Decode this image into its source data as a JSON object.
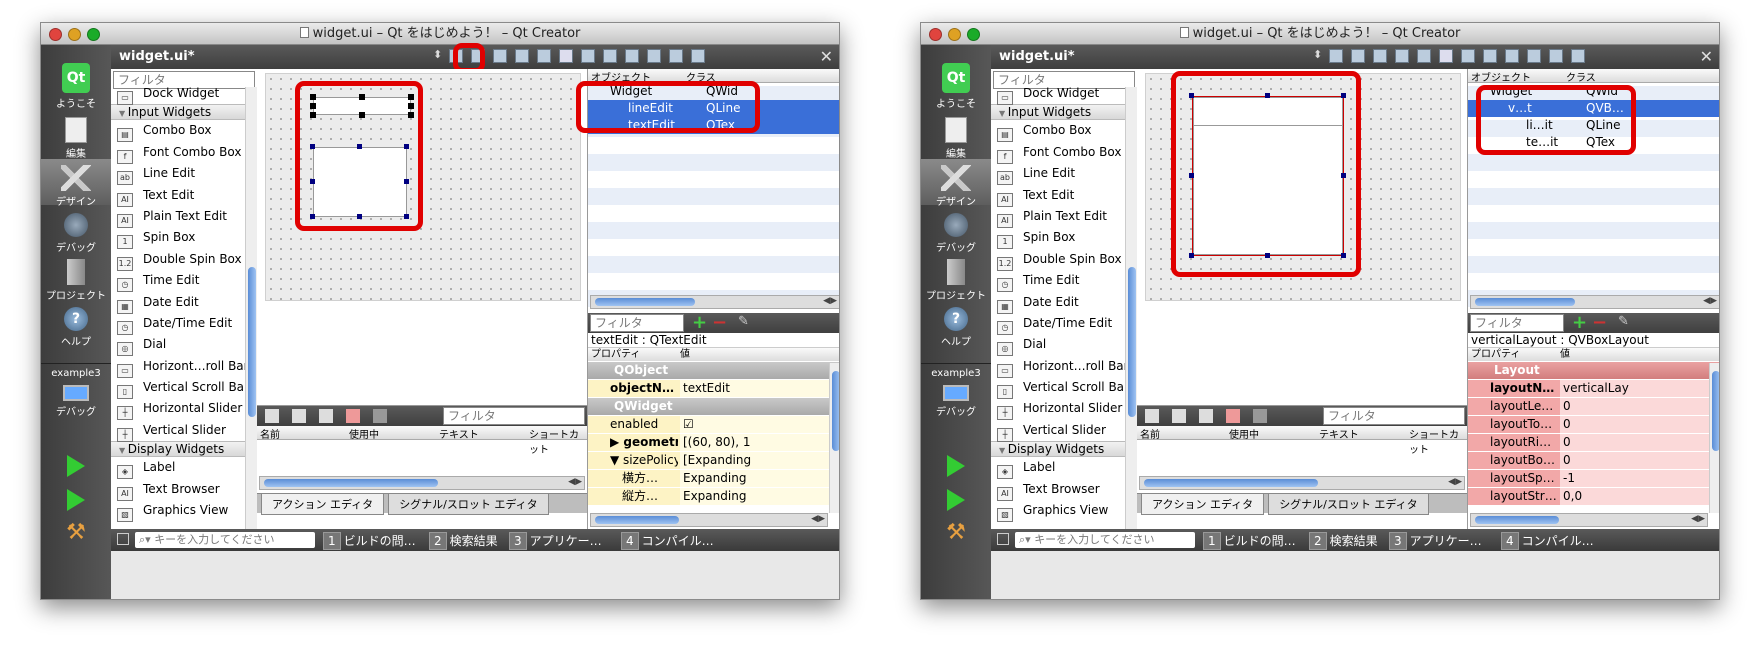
{
  "windows": [
    {
      "title": "widget.ui – Qt をはじめよう！ – Qt Creator",
      "file": "widget.ui*",
      "modes": [
        "ようこそ",
        "編集",
        "デザイン",
        "デバッグ",
        "プロジェクト",
        "ヘルプ"
      ],
      "project": "example3",
      "project_mode": "デバッグ",
      "widgetbox": {
        "filter_placeholder": "フィルタ",
        "rows": [
          {
            "type": "item",
            "label": "Dock Widget"
          },
          {
            "type": "category",
            "label": "Input Widgets"
          },
          {
            "type": "item",
            "label": "Combo Box"
          },
          {
            "type": "item",
            "label": "Font Combo Box"
          },
          {
            "type": "item",
            "label": "Line Edit"
          },
          {
            "type": "item",
            "label": "Text Edit"
          },
          {
            "type": "item",
            "label": "Plain Text Edit"
          },
          {
            "type": "item",
            "label": "Spin Box"
          },
          {
            "type": "item",
            "label": "Double Spin Box"
          },
          {
            "type": "item",
            "label": "Time Edit"
          },
          {
            "type": "item",
            "label": "Date Edit"
          },
          {
            "type": "item",
            "label": "Date/Time Edit"
          },
          {
            "type": "item",
            "label": "Dial"
          },
          {
            "type": "item",
            "label": "Horizont…roll Bar"
          },
          {
            "type": "item",
            "label": "Vertical Scroll Bar"
          },
          {
            "type": "item",
            "label": "Horizontal Slider"
          },
          {
            "type": "item",
            "label": "Vertical Slider"
          },
          {
            "type": "category",
            "label": "Display Widgets"
          },
          {
            "type": "item",
            "label": "Label"
          },
          {
            "type": "item",
            "label": "Text Browser"
          },
          {
            "type": "item",
            "label": "Graphics View"
          }
        ]
      },
      "object_inspector": {
        "col_object": "オブジェクト",
        "col_class": "クラス",
        "rows": [
          {
            "name": "Widget",
            "class": "QWid",
            "indent": 0,
            "selected": false
          },
          {
            "name": "lineEdit",
            "class": "QLine",
            "indent": 1,
            "selected": true
          },
          {
            "name": "textEdit",
            "class": "QTex",
            "indent": 1,
            "selected": true
          }
        ]
      },
      "property_filter": "フィルタ",
      "property_editor": {
        "title": "textEdit : QTextEdit",
        "col_prop": "プロパティ",
        "col_value": "値",
        "rows": [
          {
            "kind": "group",
            "name": "QObject",
            "value": ""
          },
          {
            "kind": "yellow",
            "name": "objectN…",
            "value": "textEdit",
            "bold": true
          },
          {
            "kind": "group",
            "name": "QWidget",
            "value": ""
          },
          {
            "kind": "yellow",
            "name": "enabled",
            "value": "☑",
            "bold": false
          },
          {
            "kind": "yellow",
            "name": "▶ geometry",
            "value": "[(60, 80), 1",
            "bold": true
          },
          {
            "kind": "yellow",
            "name": "▼ sizePolicy",
            "value": "[Expanding",
            "bold": false
          },
          {
            "kind": "yellow",
            "name": "　横方…",
            "value": "Expanding",
            "bold": false
          },
          {
            "kind": "yellow",
            "name": "　縦方…",
            "value": "Expanding",
            "bold": false
          }
        ]
      },
      "action_editor": {
        "filter_placeholder": "フィルタ",
        "columns": [
          "名前",
          "使用中",
          "テキスト",
          "ショートカット"
        ],
        "tabs": [
          "アクション エディタ",
          "シグナル/スロット エディタ"
        ]
      },
      "status": {
        "search_placeholder": "キーを入力してください",
        "tabs": [
          {
            "num": "1",
            "label": "ビルドの問…"
          },
          {
            "num": "2",
            "label": "検索結果"
          },
          {
            "num": "3",
            "label": "アプリケー…"
          },
          {
            "num": "4",
            "label": "コンパイル…"
          }
        ]
      }
    },
    {
      "title": "widget.ui – Qt をはじめよう！ – Qt Creator",
      "file": "widget.ui*",
      "modes": [
        "ようこそ",
        "編集",
        "デザイン",
        "デバッグ",
        "プロジェクト",
        "ヘルプ"
      ],
      "project": "example3",
      "project_mode": "デバッグ",
      "widgetbox": {
        "filter_placeholder": "フィルタ",
        "rows": [
          {
            "type": "item",
            "label": "Dock Widget"
          },
          {
            "type": "category",
            "label": "Input Widgets"
          },
          {
            "type": "item",
            "label": "Combo Box"
          },
          {
            "type": "item",
            "label": "Font Combo Box"
          },
          {
            "type": "item",
            "label": "Line Edit"
          },
          {
            "type": "item",
            "label": "Text Edit"
          },
          {
            "type": "item",
            "label": "Plain Text Edit"
          },
          {
            "type": "item",
            "label": "Spin Box"
          },
          {
            "type": "item",
            "label": "Double Spin Box"
          },
          {
            "type": "item",
            "label": "Time Edit"
          },
          {
            "type": "item",
            "label": "Date Edit"
          },
          {
            "type": "item",
            "label": "Date/Time Edit"
          },
          {
            "type": "item",
            "label": "Dial"
          },
          {
            "type": "item",
            "label": "Horizont…roll Bar"
          },
          {
            "type": "item",
            "label": "Vertical Scroll Bar"
          },
          {
            "type": "item",
            "label": "Horizontal Slider"
          },
          {
            "type": "item",
            "label": "Vertical Slider"
          },
          {
            "type": "category",
            "label": "Display Widgets"
          },
          {
            "type": "item",
            "label": "Label"
          },
          {
            "type": "item",
            "label": "Text Browser"
          },
          {
            "type": "item",
            "label": "Graphics View"
          }
        ]
      },
      "object_inspector": {
        "col_object": "オブジェクト",
        "col_class": "クラス",
        "rows": [
          {
            "name": "Widget",
            "class": "QWid",
            "indent": 0,
            "selected": false
          },
          {
            "name": "v…t",
            "class": "QVB…",
            "indent": 1,
            "selected": true
          },
          {
            "name": "li…it",
            "class": "QLine",
            "indent": 2,
            "selected": false
          },
          {
            "name": "te…it",
            "class": "QTex",
            "indent": 2,
            "selected": false
          }
        ]
      },
      "property_filter": "フィルタ",
      "property_editor": {
        "title": "verticalLayout : QVBoxLayout",
        "col_prop": "プロパティ",
        "col_value": "値",
        "rows": [
          {
            "kind": "rgroup",
            "name": "Layout",
            "value": ""
          },
          {
            "kind": "red",
            "name": "layoutN…",
            "value": "verticalLay",
            "bold": true
          },
          {
            "kind": "red",
            "name": "layoutLe…",
            "value": "0",
            "bold": false
          },
          {
            "kind": "red",
            "name": "layoutTo…",
            "value": "0",
            "bold": false
          },
          {
            "kind": "red",
            "name": "layoutRi…",
            "value": "0",
            "bold": false
          },
          {
            "kind": "red",
            "name": "layoutBo…",
            "value": "0",
            "bold": false
          },
          {
            "kind": "red",
            "name": "layoutSp…",
            "value": "-1",
            "bold": false
          },
          {
            "kind": "red",
            "name": "layoutStr…",
            "value": "0,0",
            "bold": false
          }
        ]
      },
      "action_editor": {
        "filter_placeholder": "フィルタ",
        "columns": [
          "名前",
          "使用中",
          "テキスト",
          "ショートカット"
        ],
        "tabs": [
          "アクション エディタ",
          "シグナル/スロット エディタ"
        ]
      },
      "status": {
        "search_placeholder": "キーを入力してください",
        "tabs": [
          {
            "num": "1",
            "label": "ビルドの問…"
          },
          {
            "num": "2",
            "label": "検索結果"
          },
          {
            "num": "3",
            "label": "アプリケー…"
          },
          {
            "num": "4",
            "label": "コンパイル…"
          }
        ]
      }
    }
  ]
}
